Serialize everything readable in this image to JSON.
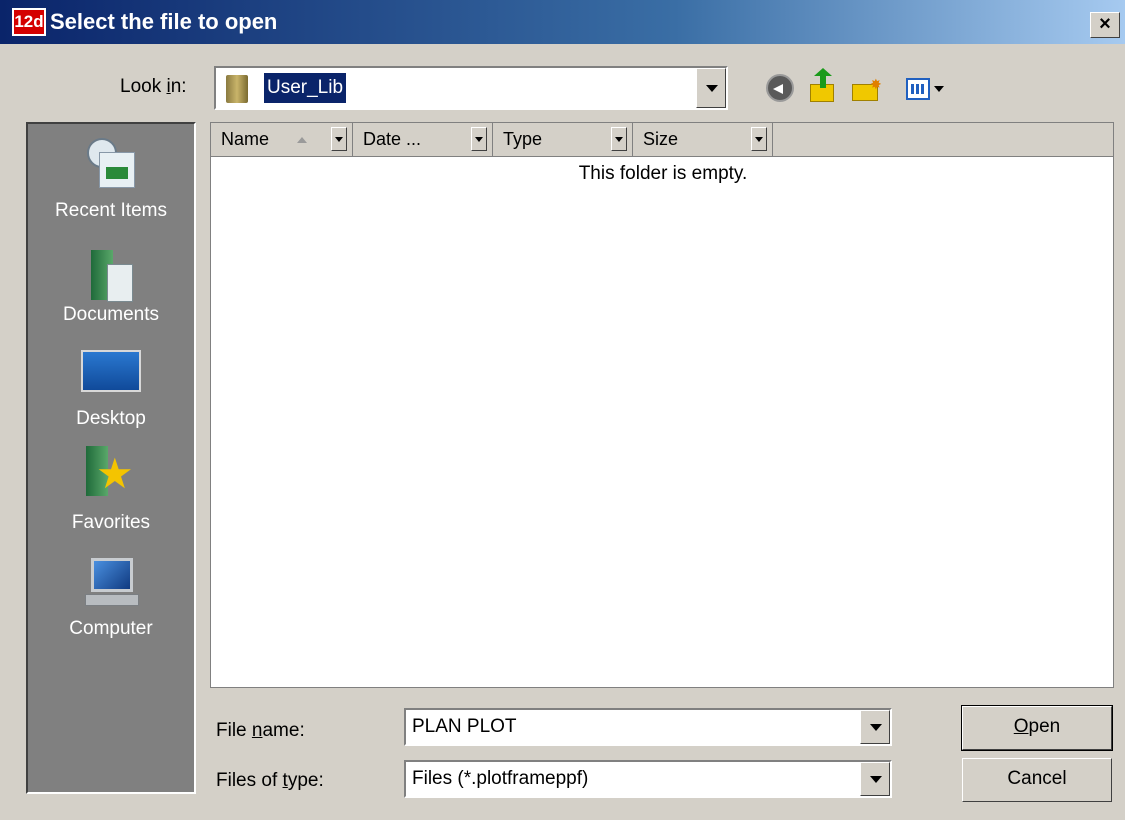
{
  "window": {
    "app_icon_text": "12d",
    "title": "Select the file to open",
    "close_label": "×"
  },
  "toolbar": {
    "look_in_label": "Look in:",
    "look_in_value": "User_Lib",
    "icons": [
      "back-icon",
      "up-one-level-icon",
      "new-folder-icon",
      "views-icon"
    ]
  },
  "places": [
    {
      "label": "Recent Items",
      "icon": "recent-items-icon"
    },
    {
      "label": "Documents",
      "icon": "documents-icon"
    },
    {
      "label": "Desktop",
      "icon": "desktop-icon"
    },
    {
      "label": "Favorites",
      "icon": "favorites-icon"
    },
    {
      "label": "Computer",
      "icon": "computer-icon"
    }
  ],
  "file_list": {
    "columns": [
      "Name",
      "Date ...",
      "Type",
      "Size"
    ],
    "empty_message": "This folder is empty."
  },
  "bottom": {
    "file_name_label": "File name:",
    "file_name_value": "PLAN PLOT",
    "file_type_label": "Files of type:",
    "file_type_value": "Files (*.plotframeppf)",
    "open_label": "Open",
    "cancel_label": "Cancel"
  },
  "colors": {
    "titlebar_start": "#0a246a",
    "titlebar_end": "#a6caf0",
    "dialog_bg": "#d4d0c8",
    "places_bg": "#808080",
    "selection": "#0a246a"
  }
}
